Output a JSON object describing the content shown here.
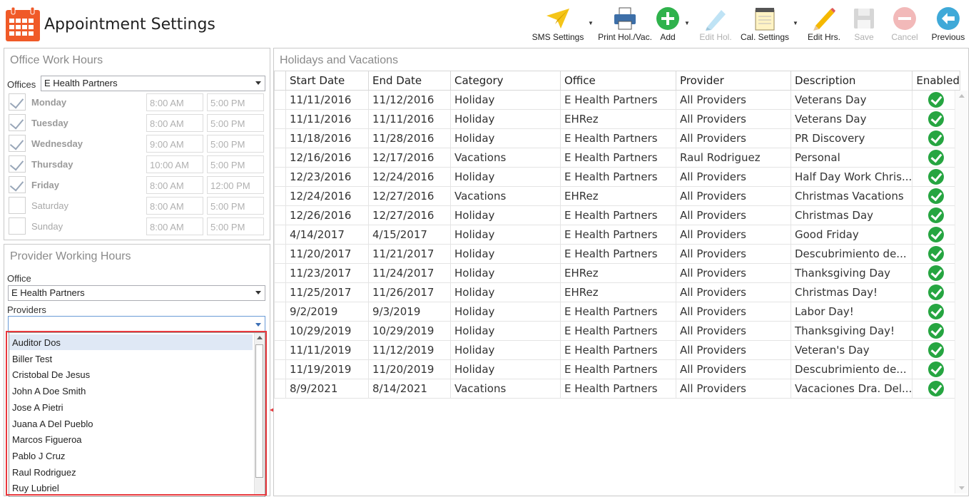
{
  "app": {
    "title": "Appointment Settings",
    "icon": "calendar-icon"
  },
  "toolbar": {
    "sms": "SMS Settings",
    "print": "Print Hol./Vac.",
    "add": "Add",
    "edit_hol": "Edit Hol.",
    "cal_settings": "Cal. Settings",
    "edit_hrs": "Edit Hrs.",
    "save": "Save",
    "cancel": "Cancel",
    "previous": "Previous"
  },
  "office_hours": {
    "title": "Office Work Hours",
    "offices_label": "Offices",
    "office_value": "E Health Partners",
    "days": [
      {
        "name": "Monday",
        "checked": true,
        "start": "8:00 AM",
        "end": "5:00 PM"
      },
      {
        "name": "Tuesday",
        "checked": true,
        "start": "8:00 AM",
        "end": "5:00 PM"
      },
      {
        "name": "Wednesday",
        "checked": true,
        "start": "9:00 AM",
        "end": "5:00 PM"
      },
      {
        "name": "Thursday",
        "checked": true,
        "start": "10:00 AM",
        "end": "5:00 PM"
      },
      {
        "name": "Friday",
        "checked": true,
        "start": "8:00 AM",
        "end": "12:00 PM"
      },
      {
        "name": "Saturday",
        "checked": false,
        "start": "8:00 AM",
        "end": "5:00 PM"
      },
      {
        "name": "Sunday",
        "checked": false,
        "start": "8:00 AM",
        "end": "5:00 PM"
      }
    ]
  },
  "provider_hours": {
    "title": "Provider Working Hours",
    "office_label": "Office",
    "office_value": "E Health Partners",
    "providers_label": "Providers",
    "providers_value": "",
    "provider_options": [
      "Auditor Dos",
      "Biller Test",
      "Cristobal De Jesus",
      "John A Doe Smith",
      "Jose A Pietri",
      "Juana A Del Pueblo",
      "Marcos Figueroa",
      "Pablo J Cruz",
      "Raul Rodriguez",
      "Ruy Lubriel"
    ]
  },
  "holidays": {
    "title": "Holidays and Vacations",
    "columns": [
      "Start Date",
      "End Date",
      "Category",
      "Office",
      "Provider",
      "Description",
      "Enabled"
    ],
    "rows": [
      [
        "11/11/2016",
        "11/12/2016",
        "Holiday",
        "E Health Partners",
        "All Providers",
        "Veterans Day"
      ],
      [
        "11/11/2016",
        "11/11/2016",
        "Holiday",
        "EHRez",
        "All Providers",
        "Veterans Day"
      ],
      [
        "11/18/2016",
        "11/28/2016",
        "Holiday",
        "E Health Partners",
        "All Providers",
        "PR Discovery"
      ],
      [
        "12/16/2016",
        "12/17/2016",
        "Vacations",
        "E Health Partners",
        "Raul Rodriguez",
        "Personal"
      ],
      [
        "12/23/2016",
        "12/24/2016",
        "Holiday",
        "E Health Partners",
        "All Providers",
        "Half Day Work Chris..."
      ],
      [
        "12/24/2016",
        "12/27/2016",
        "Vacations",
        "EHRez",
        "All Providers",
        "Christmas Vacations"
      ],
      [
        "12/26/2016",
        "12/27/2016",
        "Holiday",
        "E Health Partners",
        "All Providers",
        "Christmas Day"
      ],
      [
        "4/14/2017",
        "4/15/2017",
        "Holiday",
        "E Health Partners",
        "All Providers",
        "Good Friday"
      ],
      [
        "11/20/2017",
        "11/21/2017",
        "Holiday",
        "E Health Partners",
        "All Providers",
        "Descubrimiento de..."
      ],
      [
        "11/23/2017",
        "11/24/2017",
        "Holiday",
        "EHRez",
        "All Providers",
        "Thanksgiving Day"
      ],
      [
        "11/25/2017",
        "11/26/2017",
        "Holiday",
        "EHRez",
        "All Providers",
        "Christmas Day!"
      ],
      [
        "9/2/2019",
        "9/3/2019",
        "Holiday",
        "E Health Partners",
        "All Providers",
        "Labor Day!"
      ],
      [
        "10/29/2019",
        "10/29/2019",
        "Holiday",
        "E Health Partners",
        "All Providers",
        "Thanksgiving Day!"
      ],
      [
        "11/11/2019",
        "11/12/2019",
        "Holiday",
        "E Health Partners",
        "All Providers",
        "Veteran's Day"
      ],
      [
        "11/19/2019",
        "11/20/2019",
        "Holiday",
        "E Health Partners",
        "All Providers",
        "Descubrimiento de..."
      ],
      [
        "8/9/2021",
        "8/14/2021",
        "Vacations",
        "E Health Partners",
        "All Providers",
        "Vacaciones Dra. Del..."
      ]
    ]
  },
  "colors": {
    "accent_red": "#e8383d",
    "enabled_green": "#26a541",
    "calendar_orange": "#f05a28"
  }
}
